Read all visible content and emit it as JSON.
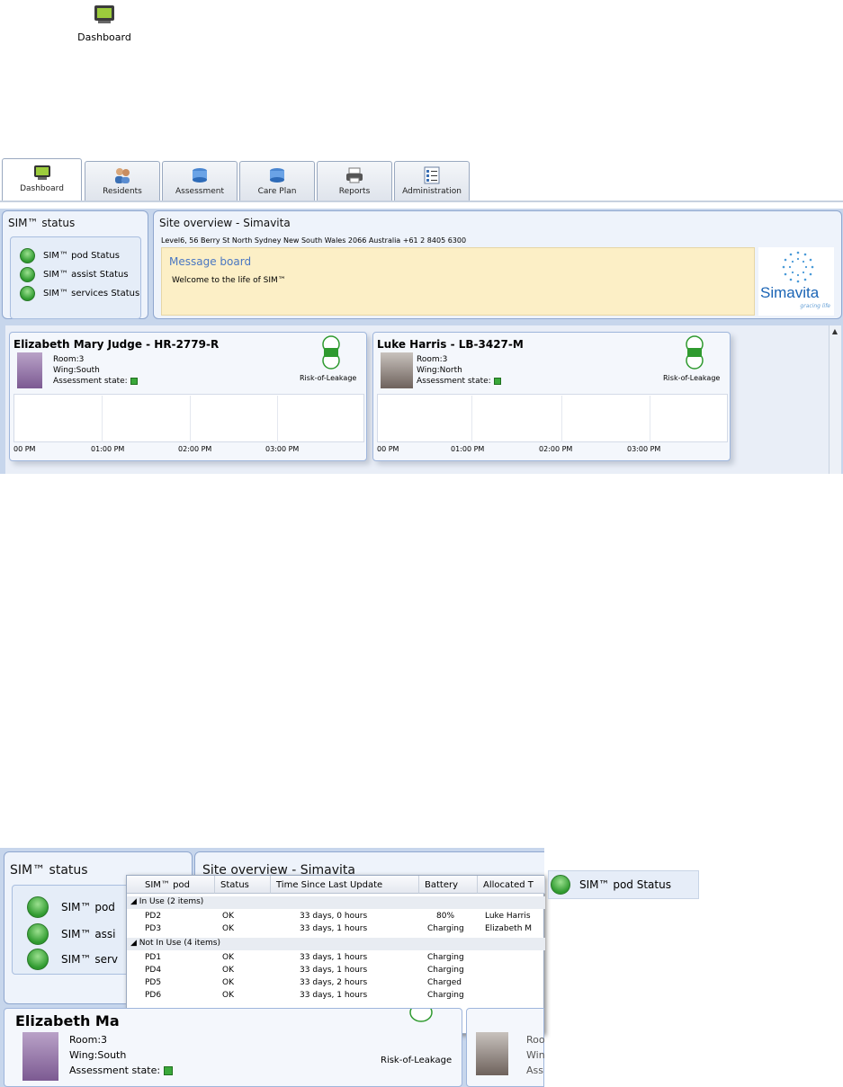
{
  "desktop_icon": {
    "label": "Dashboard"
  },
  "tabs": [
    {
      "label": "Dashboard",
      "icon": "dashboard-icon"
    },
    {
      "label": "Residents",
      "icon": "residents-icon"
    },
    {
      "label": "Assessment",
      "icon": "assessment-icon"
    },
    {
      "label": "Care Plan",
      "icon": "care-plan-icon"
    },
    {
      "label": "Reports",
      "icon": "printer-icon"
    },
    {
      "label": "Administration",
      "icon": "checklist-icon"
    }
  ],
  "sim_status": {
    "title": "SIM™ status",
    "items": [
      "SIM™ pod  Status",
      "SIM™ assist Status",
      "SIM™ services Status"
    ]
  },
  "site_overview": {
    "title": "Site overview - Simavita",
    "address": "Level6, 56 Berry St  North Sydney New South Wales 2066 Australia +61 2 8405 6300",
    "message_board_title": "Message board",
    "message_text": "Welcome to the life of SIM™",
    "logo_text": "Simavita",
    "logo_tagline": "gracing life"
  },
  "residents": [
    {
      "name": "Elizabeth Mary Judge  -  HR-2779-R",
      "room": "Room:3",
      "wing": "Wing:South",
      "assessment": "Assessment state:",
      "risk": "Risk-of-Leakage",
      "times": [
        "00 PM",
        "01:00 PM",
        "02:00 PM",
        "03:00 PM"
      ]
    },
    {
      "name": "Luke Harris  -  LB-3427-M",
      "room": "Room:3",
      "wing": "Wing:North",
      "assessment": "Assessment state:",
      "risk": "Risk-of-Leakage",
      "times": [
        "00 PM",
        "01:00 PM",
        "02:00 PM",
        "03:00 PM"
      ]
    }
  ],
  "zoom": {
    "sim_status_title": "SIM™ status",
    "site_title": "Site overview - Simavita",
    "status_items": [
      "SIM™ pod",
      "SIM™ assi",
      "SIM™ serv"
    ],
    "popup": {
      "headers": [
        "SIM™ pod",
        "Status",
        "Time Since Last Update",
        "Battery",
        "Allocated T"
      ],
      "groups": [
        {
          "label": "In Use (2 items)",
          "rows": [
            [
              "PD2",
              "OK",
              "33 days, 0 hours",
              "80%",
              "Luke Harris"
            ],
            [
              "PD3",
              "OK",
              "33 days, 1 hours",
              "Charging",
              "Elizabeth M"
            ]
          ]
        },
        {
          "label": "Not In Use (4 items)",
          "rows": [
            [
              "PD1",
              "OK",
              "33 days, 1 hours",
              "Charging",
              ""
            ],
            [
              "PD4",
              "OK",
              "33 days, 1 hours",
              "Charging",
              ""
            ],
            [
              "PD5",
              "OK",
              "33 days, 2 hours",
              "Charged",
              ""
            ],
            [
              "PD6",
              "OK",
              "33 days, 1 hours",
              "Charging",
              ""
            ]
          ]
        }
      ]
    },
    "card_name": "Elizabeth Ma",
    "card_room": "Room:3",
    "card_wing": "Wing:South",
    "card_assessment": "Assessment state:",
    "card_risk": "Risk-of-Leakage",
    "card2_lines": [
      "Roo",
      "Win",
      "Ass"
    ],
    "chip_label": "SIM™ pod  Status"
  }
}
